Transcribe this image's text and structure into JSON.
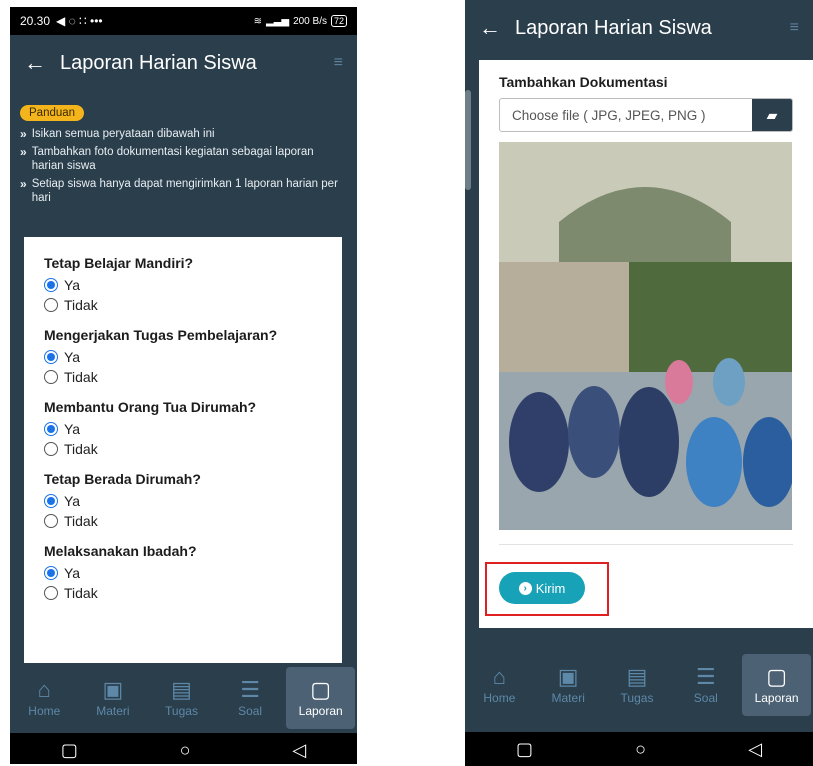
{
  "left": {
    "status": {
      "time": "20.30",
      "icons_left": "◀ ◌ ∷ •••",
      "net": "200 B/s",
      "battery": "72"
    },
    "appbar": {
      "title": "Laporan Harian Siswa"
    },
    "guide": {
      "badge": "Panduan",
      "items": [
        "Isikan semua peryataan dibawah ini",
        "Tambahkan foto dokumentasi kegiatan sebagai laporan harian siswa",
        "Setiap siswa hanya dapat mengirimkan 1 laporan harian per hari"
      ]
    },
    "questions": [
      {
        "title": "Tetap Belajar Mandiri?",
        "yes": "Ya",
        "no": "Tidak"
      },
      {
        "title": "Mengerjakan Tugas Pembelajaran?",
        "yes": "Ya",
        "no": "Tidak"
      },
      {
        "title": "Membantu Orang Tua Dirumah?",
        "yes": "Ya",
        "no": "Tidak"
      },
      {
        "title": "Tetap Berada Dirumah?",
        "yes": "Ya",
        "no": "Tidak"
      },
      {
        "title": "Melaksanakan Ibadah?",
        "yes": "Ya",
        "no": "Tidak"
      }
    ]
  },
  "right": {
    "appbar": {
      "title": "Laporan Harian Siswa"
    },
    "doc_title": "Tambahkan Dokumentasi",
    "file_placeholder": "Choose file ( JPG, JPEG, PNG )",
    "submit_label": "Kirim"
  },
  "nav": [
    {
      "label": "Home",
      "icon": "home-icon"
    },
    {
      "label": "Materi",
      "icon": "presentation-icon"
    },
    {
      "label": "Tugas",
      "icon": "book-icon"
    },
    {
      "label": "Soal",
      "icon": "list-icon"
    },
    {
      "label": "Laporan",
      "icon": "clipboard-icon"
    }
  ],
  "nav_right_laporan": "Laporan",
  "colors": {
    "primary": "#2b3e4c",
    "accent": "#17a2b8",
    "badge": "#f3b51b",
    "highlight": "#e02020"
  }
}
